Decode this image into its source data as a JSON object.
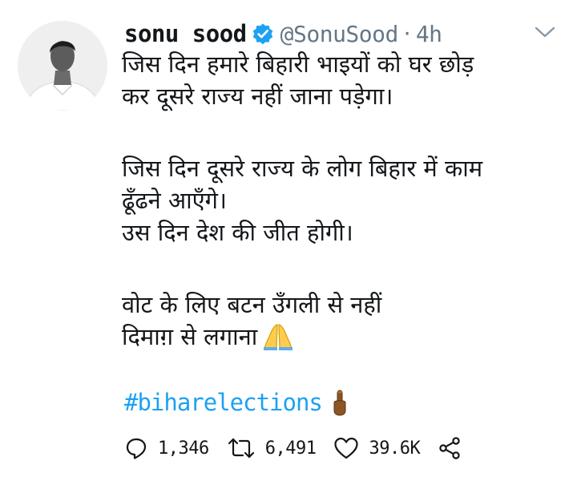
{
  "tweet": {
    "author": {
      "display_name": "sonu sood",
      "handle": "@SonuSood",
      "verified": true,
      "avatar_icon": "profile-photo"
    },
    "separator": "·",
    "timestamp": "4h",
    "menu_icon": "chevron-down-icon",
    "text_lines": [
      "जिस दिन हमारे बिहारी भाइयों को घर छोड़",
      "कर दूसरे राज्य नहीं जाना पड़ेगा।",
      "जिस दिन दूसरे राज्य के लोग बिहार में काम",
      "ढूँढने आएँगे।",
      "उस दिन देश की जीत होगी।",
      "वोट के लिए बटन उँगली से नहीं",
      "दिमाग़ से लगाना"
    ],
    "hashtag": "#biharelections",
    "emojis": {
      "folded_hands": "folded-hands-emoji",
      "pointing_finger": "index-pointing-up-emoji"
    },
    "stats": {
      "replies": "1,346",
      "retweets": "6,491",
      "likes": "39.6K"
    },
    "colors": {
      "text": "#14171a",
      "secondary": "#657786",
      "link": "#1da1f2",
      "verified_badge": "#1da1f2"
    }
  }
}
